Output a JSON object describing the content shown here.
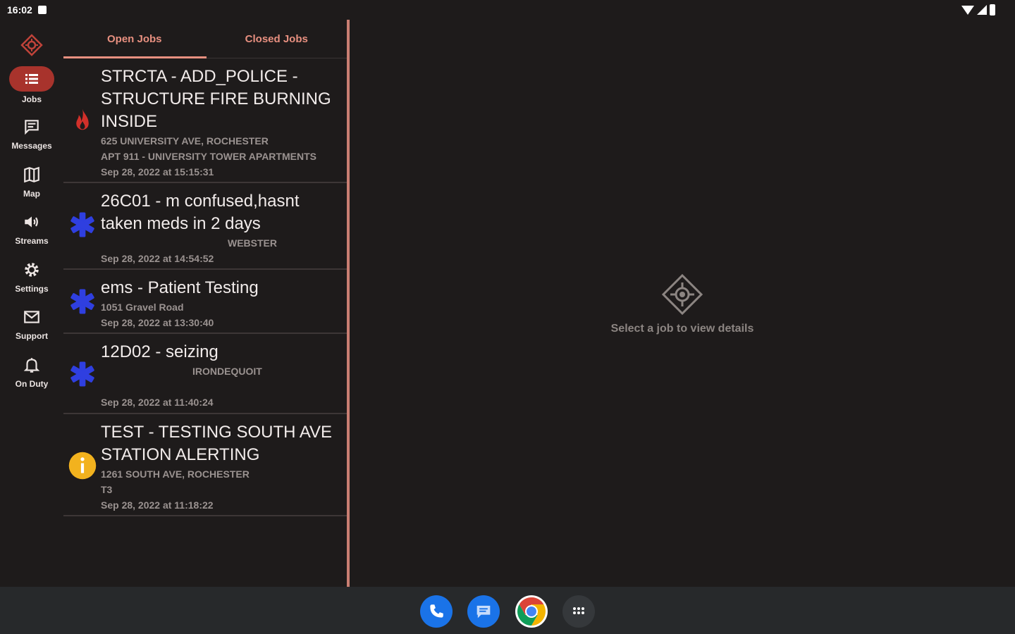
{
  "status_bar": {
    "time": "16:02"
  },
  "rail": {
    "items": [
      {
        "label": "Jobs",
        "icon": "list-icon",
        "active": true
      },
      {
        "label": "Messages",
        "icon": "message-icon"
      },
      {
        "label": "Map",
        "icon": "map-icon"
      },
      {
        "label": "Streams",
        "icon": "speaker-icon"
      },
      {
        "label": "Settings",
        "icon": "gear-icon"
      },
      {
        "label": "Support",
        "icon": "mail-icon"
      },
      {
        "label": "On Duty",
        "icon": "bell-icon"
      }
    ]
  },
  "tabs": [
    {
      "label": "Open Jobs",
      "selected": true
    },
    {
      "label": "Closed Jobs",
      "selected": false
    }
  ],
  "jobs": [
    {
      "icon": "fire-icon",
      "title": "STRCTA - ADD_POLICE - STRUCTURE FIRE BURNING INSIDE",
      "lines": [
        "625 UNIVERSITY AVE, ROCHESTER",
        "APT 911 - UNIVERSITY TOWER APARTMENTS",
        "Sep 28, 2022 at 15:15:31"
      ]
    },
    {
      "icon": "star-of-life-icon",
      "title": "26C01 - m confused,hasnt taken meds in 2 days",
      "lines": [
        "WEBSTER",
        "Sep 28, 2022 at 14:54:52"
      ]
    },
    {
      "icon": "star-of-life-icon",
      "title": "ems - Patient Testing",
      "lines": [
        "1051 Gravel Road",
        "Sep 28, 2022 at 13:30:40"
      ]
    },
    {
      "icon": "star-of-life-icon",
      "title": "12D02 - seizing",
      "lines": [
        "IRONDEQUOIT",
        "",
        "Sep 28, 2022 at 11:40:24"
      ]
    },
    {
      "icon": "info-icon",
      "title": "TEST - TESTING SOUTH AVE STATION ALERTING",
      "lines": [
        "1261 SOUTH AVE, ROCHESTER",
        "T3",
        "Sep 28, 2022 at 11:18:22"
      ]
    }
  ],
  "detail": {
    "empty_text": "Select a job to view details"
  },
  "colors": {
    "accent": "#e89080",
    "active_pill": "#a8332c",
    "ems_blue": "#2f3fe0",
    "fire_red": "#d2302a",
    "info_yellow": "#f2b21e"
  },
  "dock": [
    {
      "name": "phone-app-icon"
    },
    {
      "name": "messages-app-icon"
    },
    {
      "name": "chrome-app-icon"
    },
    {
      "name": "app-drawer-icon"
    }
  ]
}
